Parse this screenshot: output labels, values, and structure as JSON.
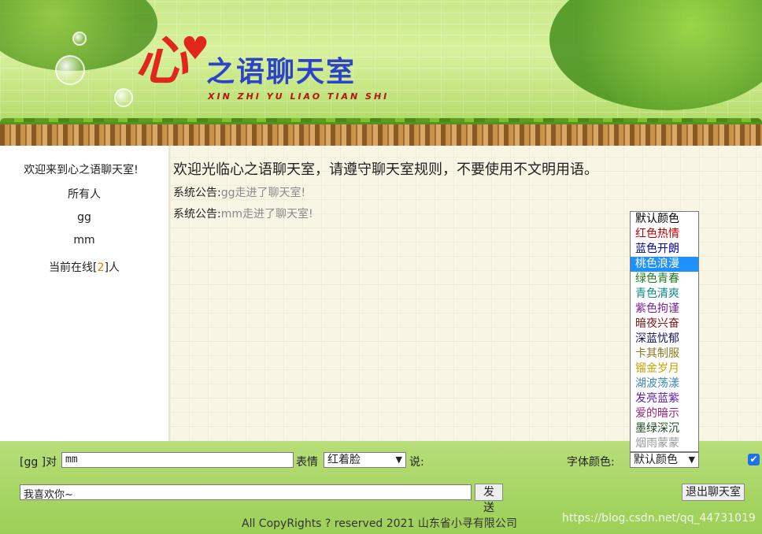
{
  "logo": {
    "big_char": "心",
    "heart_icon": "heart-icon",
    "title_rest": "之语聊天室",
    "pinyin": "XIN ZHI YU LIAO TIAN SHI"
  },
  "sidebar": {
    "welcome": "欢迎来到心之语聊天室!",
    "users": [
      "所有人",
      "gg",
      "mm"
    ],
    "online_prefix": "当前在线[",
    "online_count": "2",
    "online_suffix": "]人"
  },
  "main": {
    "welcome": "欢迎光临心之语聊天室，请遵守聊天室规则，不要使用不文明用语。",
    "messages": [
      {
        "label": "系统公告:",
        "text": "gg走进了聊天室!"
      },
      {
        "label": "系统公告:",
        "text": "mm走进了聊天室!"
      }
    ]
  },
  "color_dropdown": {
    "options": [
      {
        "label": "默认颜色",
        "color": "#000000"
      },
      {
        "label": "红色热情",
        "color": "#c00000"
      },
      {
        "label": "蓝色开朗",
        "color": "#0000aa"
      },
      {
        "label": "桃色浪漫",
        "color": "#ffffff",
        "selected": true
      },
      {
        "label": "绿色青春",
        "color": "#1b7f1b"
      },
      {
        "label": "青色清爽",
        "color": "#128a8a"
      },
      {
        "label": "紫色拘谨",
        "color": "#7a1f99"
      },
      {
        "label": "暗夜兴奋",
        "color": "#7a1515"
      },
      {
        "label": "深蓝忧郁",
        "color": "#101060"
      },
      {
        "label": "卡其制服",
        "color": "#8a7a22"
      },
      {
        "label": "镏金岁月",
        "color": "#c8a200"
      },
      {
        "label": "湖波荡漾",
        "color": "#3a8ab8"
      },
      {
        "label": "发亮蓝紫",
        "color": "#5a1ab0"
      },
      {
        "label": "爱的暗示",
        "color": "#a0207a"
      },
      {
        "label": "墨绿深沉",
        "color": "#1e4a1e"
      },
      {
        "label": "烟雨蒙蒙",
        "color": "#9a9a9a"
      }
    ]
  },
  "bottom": {
    "sender": "[gg ]对",
    "target_value": "mm",
    "expression_label": "表情",
    "expression_value": "红着脸",
    "say_label": "说:",
    "font_color_label": "字体颜色:",
    "font_color_value": "默认颜色",
    "message_value": "我喜欢你~",
    "send_button": "发送",
    "exit_button": "退出聊天室",
    "checkbox_checked": true,
    "copyright": "All CopyRights ? reserved 2021 山东省小寻有限公司",
    "watermark": "https://blog.csdn.net/qq_44731019"
  }
}
